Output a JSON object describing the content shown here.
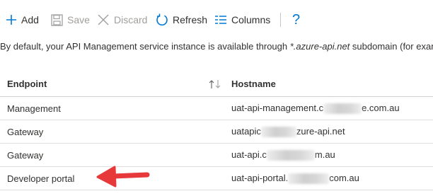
{
  "toolbar": {
    "add": "Add",
    "save": "Save",
    "discard": "Discard",
    "refresh": "Refresh",
    "columns": "Columns",
    "help": "?"
  },
  "intro": {
    "before": "By default, your API Management service instance is available through ",
    "domain": "*.azure-api.net",
    "after": " subdomain (for exam"
  },
  "table": {
    "headers": {
      "endpoint": "Endpoint",
      "hostname": "Hostname"
    },
    "rows": [
      {
        "endpoint": "Management",
        "host_start": "uat-api-management.c",
        "host_end": "e.com.au"
      },
      {
        "endpoint": "Gateway",
        "host_start": "uatapic",
        "host_end": "zure-api.net"
      },
      {
        "endpoint": "Gateway",
        "host_start": "uat-api.c",
        "host_end": "m.au"
      },
      {
        "endpoint": "Developer portal",
        "host_start": "uat-api-portal.",
        "host_end": "com.au"
      }
    ]
  },
  "colors": {
    "accent": "#0078d4",
    "arrow": "#e8393a"
  },
  "icons": [
    "add-icon",
    "save-icon",
    "discard-icon",
    "refresh-icon",
    "columns-icon",
    "sort-icon",
    "red-arrow"
  ]
}
